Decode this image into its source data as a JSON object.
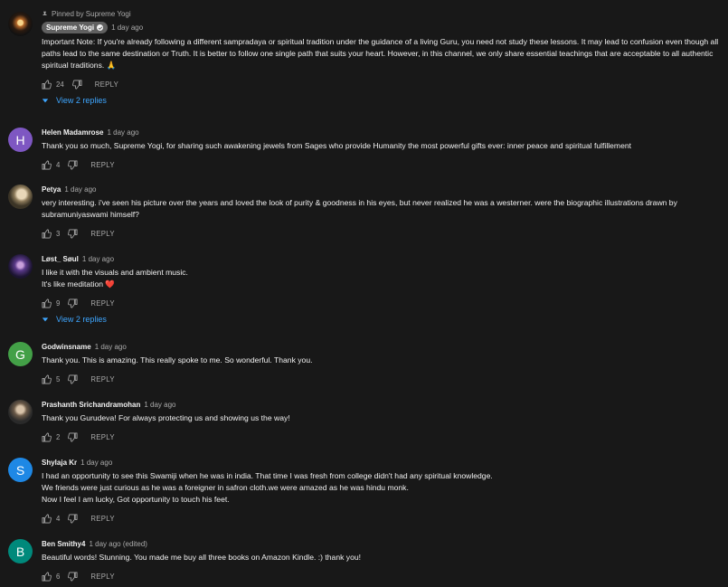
{
  "comments": [
    {
      "pinned_label": "Pinned by Supreme Yogi",
      "author": "Supreme Yogi",
      "time": "1 day ago",
      "text": "Important Note: If you're already following a different sampradaya or spiritual tradition under the guidance of a living Guru, you need not study these lessons. It may lead to confusion even though all paths lead to the same destination or Truth. It is better to follow one single path that suits your heart. However, in this channel, we only share essential teachings that are acceptable to all authentic spiritual traditions. 🙏",
      "likes": "24",
      "reply": "REPLY",
      "view_replies": "View 2 replies"
    },
    {
      "author": "Helen Madamrose",
      "time": "1 day ago",
      "avatar_letter": "H",
      "avatar_color": "#7e57c2",
      "text": "Thank you so much, Supreme Yogi, for sharing such awakening jewels from Sages who provide Humanity the most powerful gifts ever: inner peace and spiritual fulfillement",
      "likes": "4",
      "reply": "REPLY"
    },
    {
      "author": "Petya",
      "time": "1 day ago",
      "text": "very interesting. i've seen his picture over the years and loved the look of purity & goodness in his eyes, but never realized he was a westerner. were the biographic illustrations drawn by subramuniyaswami himself?",
      "likes": "3",
      "reply": "REPLY"
    },
    {
      "author": "Løst_ Søul",
      "time": "1 day ago",
      "text": "I like it with the visuals and ambient music.\nIt's like meditation ❤️",
      "likes": "9",
      "reply": "REPLY",
      "view_replies": "View 2 replies"
    },
    {
      "author": "Godwinsname",
      "time": "1 day ago",
      "avatar_letter": "G",
      "avatar_color": "#43a047",
      "text": "Thank you. This is amazing. This really spoke to me. So wonderful. Thank you.",
      "likes": "5",
      "reply": "REPLY"
    },
    {
      "author": "Prashanth Srichandramohan",
      "time": "1 day ago",
      "text": "Thank you Gurudeva! For always protecting us and showing us the way!",
      "likes": "2",
      "reply": "REPLY"
    },
    {
      "author": "Shylaja Kr",
      "time": "1 day ago",
      "avatar_letter": "S",
      "avatar_color": "#1e88e5",
      "text": "I had an opportunity to see this Swamiji when he was in india. That time I was fresh from college didn't had  any spiritual knowledge.\nWe friends were just curious as he was a foreigner in safron cloth.we were amazed     as he was hindu monk.\nNow I feel I am lucky, Got opportunity to touch his feet.",
      "likes": "4",
      "reply": "REPLY"
    },
    {
      "author": "Ben Smithy4",
      "time": "1 day ago (edited)",
      "avatar_letter": "B",
      "avatar_color": "#00897b",
      "text": "Beautiful words! Stunning.  You made me buy all three books on Amazon Kindle. :) thank you!",
      "likes": "6",
      "reply": "REPLY"
    }
  ],
  "icons": {
    "like": "thumbs-up-icon",
    "dislike": "thumbs-down-icon",
    "pin": "pin-icon",
    "verified": "checkmark-icon",
    "expand": "caret-down-icon"
  },
  "colors": {
    "background": "#181818",
    "link": "#3ea6ff",
    "secondary_text": "#aaaaaa"
  }
}
